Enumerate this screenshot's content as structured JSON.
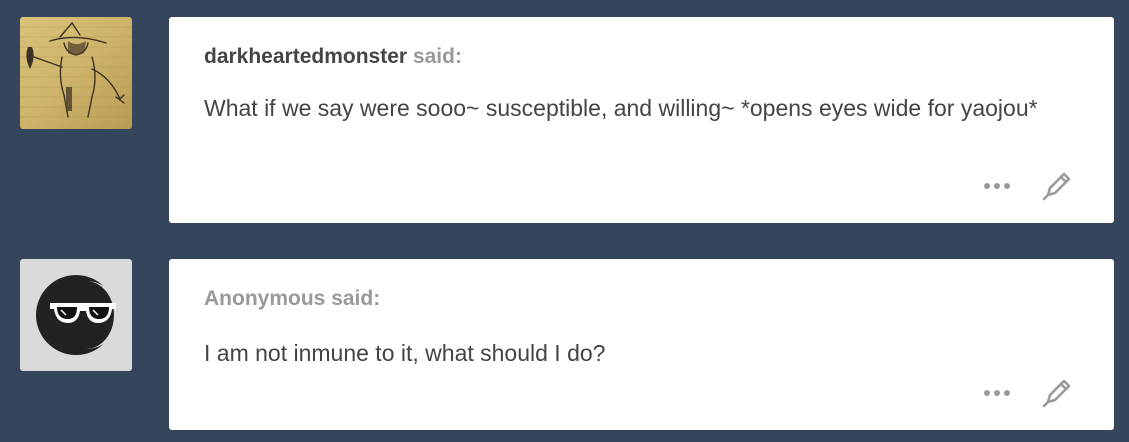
{
  "posts": [
    {
      "asker": "darkheartedmonster",
      "said": "said:",
      "question": "What if we say were sooo~ susceptible, and willing~ *opens eyes wide for yaojou*",
      "avatar": "sketch-drawing-avatar"
    },
    {
      "asker": "Anonymous",
      "said": "said:",
      "question": "I am not inmune to it, what should I do?",
      "avatar": "anonymous-sunglasses-avatar"
    }
  ],
  "icons": {
    "more": "more-dots-icon",
    "edit": "pencil-edit-icon"
  },
  "colors": {
    "background": "#35465c",
    "card": "#ffffff",
    "text": "#444444",
    "muted": "#999999",
    "icon": "#9a9a9a"
  }
}
